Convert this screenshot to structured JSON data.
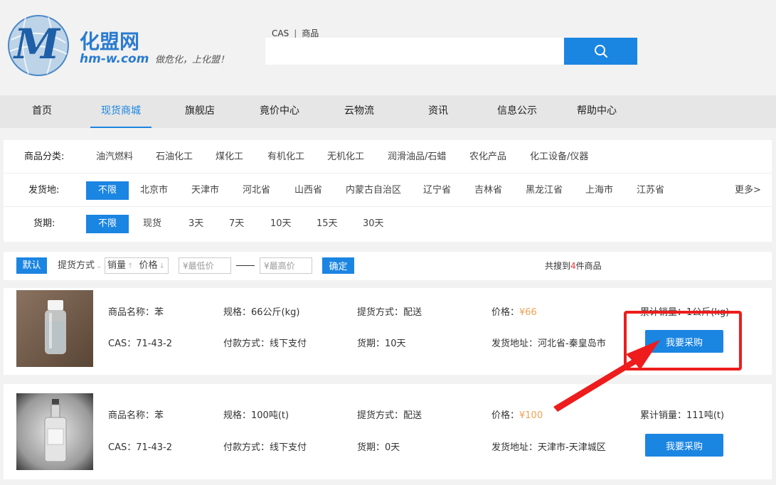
{
  "logo": {
    "brand": "化盟网",
    "domain": "hm-w.com",
    "slogan": "做危化，上化盟！",
    "letter": "M"
  },
  "search": {
    "tab_cas": "CAS",
    "tab_sep": "|",
    "tab_goods": "商品",
    "placeholder": "",
    "button_icon": "search-icon"
  },
  "nav": {
    "items": [
      {
        "label": "首页"
      },
      {
        "label": "现货商城"
      },
      {
        "label": "旗舰店"
      },
      {
        "label": "竟价中心"
      },
      {
        "label": "云物流"
      },
      {
        "label": "资讯"
      },
      {
        "label": "信息公示"
      },
      {
        "label": "帮助中心"
      }
    ],
    "active_index": 1
  },
  "filters": {
    "category": {
      "label": "商品分类:",
      "items": [
        "油汽燃料",
        "石油化工",
        "煤化工",
        "有机化工",
        "无机化工",
        "润滑油品/石蜡",
        "农化产品",
        "化工设备/仪器"
      ]
    },
    "origin": {
      "label": "发货地:",
      "items": [
        "不限",
        "北京市",
        "天津市",
        "河北省",
        "山西省",
        "内蒙古自治区",
        "辽宁省",
        "吉林省",
        "黑龙江省",
        "上海市",
        "江苏省"
      ],
      "more": "更多>"
    },
    "delivery": {
      "label": "货期:",
      "items": [
        "不限",
        "现货",
        "3天",
        "7天",
        "10天",
        "15天",
        "30天"
      ]
    }
  },
  "sortbar": {
    "default": "默认",
    "pickup": "提货方式",
    "pickup_caret": "⌄",
    "sales": "销量",
    "price": "价格",
    "arrow_up": "↑",
    "arrow_down": "↓",
    "min_price": "¥最低价",
    "max_price": "¥最高价",
    "confirm": "确定",
    "result_pre": "共搜到",
    "result_num": "4",
    "result_post": "件商品"
  },
  "products": [
    {
      "name": "商品名称：苯",
      "cas": "CAS：71-43-2",
      "spec": "规格：66公斤(kg)",
      "payment": "付款方式：线下支付",
      "pickup": "提货方式：配送",
      "delivery": "货期：10天",
      "price_label": "价格：",
      "price": "¥66",
      "address": "发货地址：河北省-秦皇岛市",
      "sales": "累计销量：1公斤(kg)",
      "buy": "我要采购"
    },
    {
      "name": "商品名称：苯",
      "cas": "CAS：71-43-2",
      "spec": "规格：100吨(t)",
      "payment": "付款方式：线下支付",
      "pickup": "提货方式：配送",
      "delivery": "货期：0天",
      "price_label": "价格：",
      "price": "¥100",
      "address": "发货地址：天津市-天津城区",
      "sales": "累计销量：111吨(t)",
      "buy": "我要采购"
    }
  ],
  "colors": {
    "accent": "#1b85e2",
    "price": "#f0a050",
    "annotation": "#ee1c1c"
  }
}
